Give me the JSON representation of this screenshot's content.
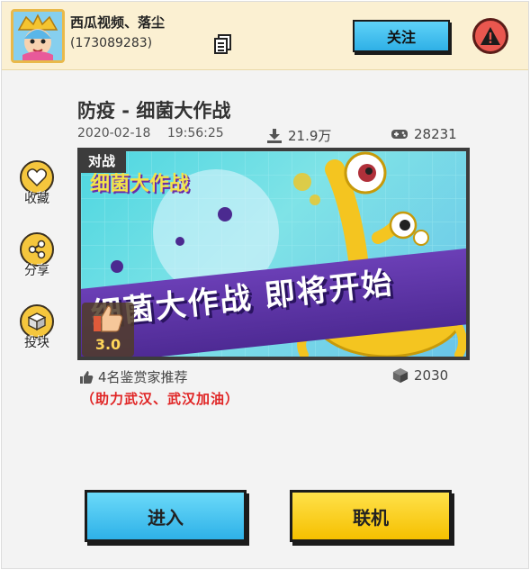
{
  "header": {
    "username": "西瓜视频、落尘",
    "user_id": "(173089283)",
    "follow_label": "关注",
    "icons": [
      "avatar",
      "document-icon",
      "warning-icon"
    ]
  },
  "game": {
    "title": "防疫 - 细菌大作战",
    "date": "2020-02-18",
    "time": "19:56:25",
    "downloads": "21.9万",
    "players": "28231",
    "tag": "对战",
    "cover_logo": "细菌大作战",
    "cover_banner": "细菌大作战 即将开始",
    "rating": "3.0",
    "recommend": "4名鉴赏家推荐",
    "slogan": "（助力武汉、武汉加油）",
    "cube_count": "2030"
  },
  "side": {
    "favorite": "收藏",
    "share": "分享",
    "vote": "投块"
  },
  "actions": {
    "enter": "进入",
    "online": "联机"
  },
  "colors": {
    "header_bg": "#fbf0d2",
    "follow_btn": "#2fb0e6",
    "warn": "#e9574f",
    "side_btn": "#f5c63d",
    "enter_btn": "#2eb1e8",
    "online_btn": "#f5c000",
    "slogan": "#e02424"
  }
}
